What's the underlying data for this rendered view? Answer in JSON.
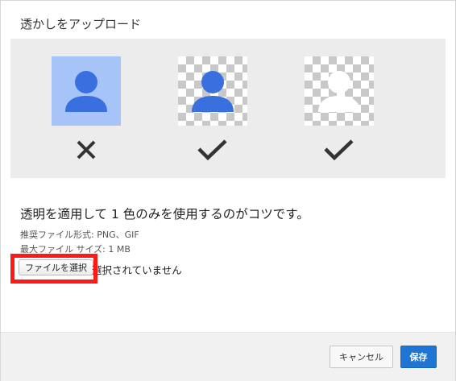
{
  "dialog": {
    "title": "透かしをアップロード"
  },
  "preview": {
    "examples": [
      {
        "tile": "blue-background",
        "icon": "person-icon",
        "icon_color": "#3a6fe0",
        "background": "#a6c4f8",
        "result": "cross-icon"
      },
      {
        "tile": "transparent-checker",
        "icon": "person-icon",
        "icon_color": "#3a6fe0",
        "result": "check-icon"
      },
      {
        "tile": "transparent-checker",
        "icon": "person-icon",
        "icon_color": "#ffffff",
        "result": "check-icon"
      }
    ],
    "mark_color": "#333333"
  },
  "info": {
    "tip": "透明を適用して 1 色のみを使用するのがコツです。",
    "recommended_format": "推奨ファイル形式: PNG、GIF",
    "max_size": "最大ファイル サイズ: 1 MB"
  },
  "file": {
    "button_label": "ファイルを選択",
    "status": "選択されていません"
  },
  "highlight": {
    "color": "#ff1a1a"
  },
  "footer": {
    "cancel_label": "キャンセル",
    "save_label": "保存"
  },
  "colors": {
    "accent": "#1f75d4",
    "preview_bg": "#ececec",
    "footer_bg": "#f1f1f1"
  }
}
